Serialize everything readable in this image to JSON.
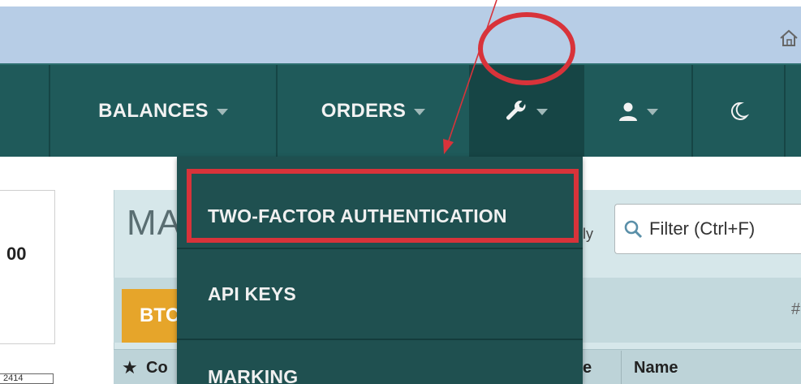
{
  "nav": {
    "balances_label": "BALANCES",
    "orders_label": "ORDERS"
  },
  "dropdown": {
    "items": [
      {
        "label": "TWO-FACTOR AUTHENTICATION"
      },
      {
        "label": "API KEYS"
      },
      {
        "label": "MARKING"
      }
    ]
  },
  "market": {
    "title_partial": "MA",
    "only_partial": "ly",
    "filter_placeholder": "Filter (Ctrl+F)",
    "active_tab_partial": "BTC",
    "hash": "#",
    "columns": [
      "Co",
      "e",
      "Name"
    ]
  },
  "left": {
    "value_partial": "00",
    "bottom_value_partial": "2414"
  },
  "colors": {
    "nav_bg": "#1f5a5a",
    "dropdown_bg": "#1f5050",
    "annotation_red": "#d8333a",
    "tab_orange": "#e6a52a",
    "top_bar": "#b7cde6"
  }
}
